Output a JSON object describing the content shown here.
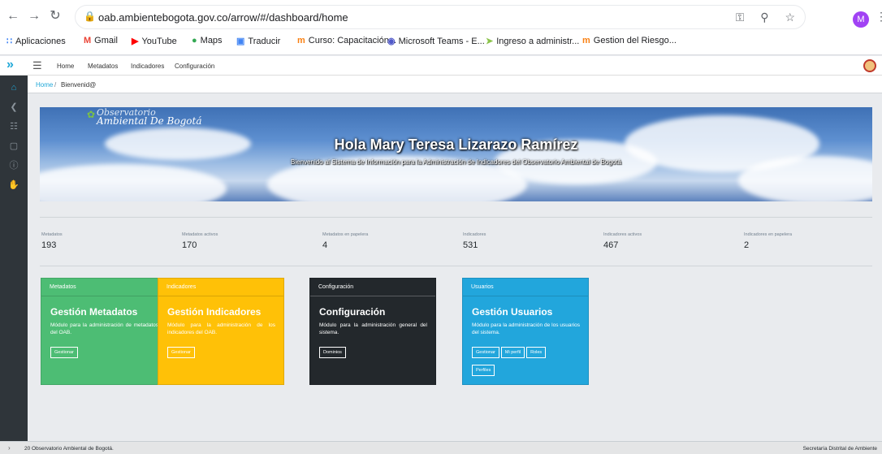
{
  "browser": {
    "url": "oab.ambientebogota.gov.co/arrow/#/dashboard/home",
    "profile_initial": "M",
    "bookmarks": [
      {
        "label": "Aplicaciones",
        "icon": "apps-grid-icon"
      },
      {
        "label": "Gmail",
        "icon": "gmail-icon"
      },
      {
        "label": "YouTube",
        "icon": "youtube-icon"
      },
      {
        "label": "Maps",
        "icon": "maps-pin-icon"
      },
      {
        "label": "Traducir",
        "icon": "translate-icon"
      },
      {
        "label": "Curso: Capacitación...",
        "icon": "moodle-icon"
      },
      {
        "label": "Microsoft Teams - E...",
        "icon": "teams-icon"
      },
      {
        "label": "Ingreso a administr...",
        "icon": "bookmark-icon"
      },
      {
        "label": "Gestion del Riesgo...",
        "icon": "moodle-icon"
      }
    ]
  },
  "header": {
    "menu": [
      "Home",
      "Metadatos",
      "Indicadores",
      "Configuración"
    ]
  },
  "breadcrumb": {
    "home": "Home",
    "separator": "/",
    "current": "Bienvenid@"
  },
  "banner": {
    "logo_line1": "Observatorio",
    "logo_line2": "Ambiental De Bogotá",
    "title": "Hola Mary Teresa Lizarazo Ramírez",
    "subtitle": "Bienvenido al Sistema de Información para la Administración de Indicadores del Observatorio Ambiental de Bogotá"
  },
  "stats": [
    {
      "label": "Metadatos",
      "value": "193"
    },
    {
      "label": "Metadatos activos",
      "value": "170"
    },
    {
      "label": "Metadatos en papelera",
      "value": "4"
    },
    {
      "label": "Indicadores",
      "value": "531"
    },
    {
      "label": "Indicadores activos",
      "value": "467"
    },
    {
      "label": "Indicadores en papelera",
      "value": "2"
    }
  ],
  "cards": {
    "metadatos": {
      "header": "Metadatos",
      "title": "Gestión Metadatos",
      "description": "Módulo para la administración de metadatos del OAB.",
      "buttons": [
        "Gestionar"
      ],
      "color": "#4dbd74"
    },
    "indicadores": {
      "header": "Indicadores",
      "title": "Gestión Indicadores",
      "description": "Módulo para la administración de los indicadores del OAB.",
      "buttons": [
        "Gestionar"
      ],
      "color": "#ffc107"
    },
    "configuracion": {
      "header": "Configuración",
      "title": "Configuración",
      "description": "Módulo para la administración general del sistema.",
      "buttons": [
        "Dominios"
      ],
      "color": "#23282c"
    },
    "usuarios": {
      "header": "Usuarios",
      "title": "Gestión Usuarios",
      "description": "Módulo para la administración de los usuarios del sistema.",
      "buttons": [
        "Gestionar",
        "Mi perfil",
        "Roles",
        "Perfiles"
      ],
      "color": "#22a6dc"
    }
  },
  "footer": {
    "left": "20 Observatorio Ambiental de Bogotá.",
    "right": "Secretaría Distrital de Ambiente"
  }
}
